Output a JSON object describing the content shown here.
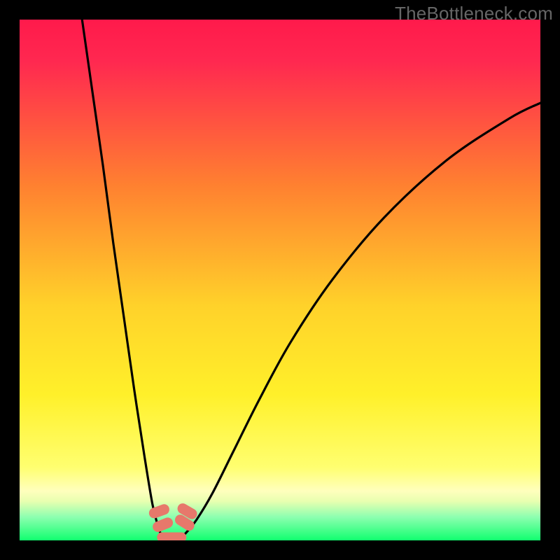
{
  "watermark": "TheBottleneck.com",
  "colors": {
    "frame": "#000000",
    "grad_top": "#ff1a4b",
    "grad_mid1": "#ff8f2a",
    "grad_mid2": "#fff02a",
    "grad_band_pale": "#ffffad",
    "grad_bottom": "#19ff7a",
    "curve_stroke": "#000000",
    "marker_fill": "#e7786b"
  },
  "chart_data": {
    "type": "line",
    "title": "",
    "xlabel": "",
    "ylabel": "",
    "xlim": [
      0,
      100
    ],
    "ylim": [
      0,
      100
    ],
    "series": [
      {
        "name": "left-branch",
        "x": [
          12,
          14,
          16,
          18,
          20,
          22,
          24,
          25.5,
          26.5,
          27,
          27.5,
          28
        ],
        "y": [
          100,
          86,
          72,
          57,
          43,
          29,
          16,
          7,
          3,
          1.5,
          1,
          0.5
        ]
      },
      {
        "name": "right-branch",
        "x": [
          31,
          32,
          34,
          37,
          41,
          46,
          52,
          60,
          70,
          82,
          94,
          100
        ],
        "y": [
          0.5,
          1.5,
          4,
          9,
          17,
          27,
          38,
          50,
          62,
          73,
          81,
          84
        ]
      },
      {
        "name": "valley-floor",
        "x": [
          27,
          28,
          29,
          30,
          31,
          32
        ],
        "y": [
          1.2,
          0.5,
          0.3,
          0.3,
          0.5,
          1.4
        ]
      }
    ],
    "markers": [
      {
        "name": "left-upper-marker",
        "x": 26.8,
        "y": 5.6,
        "shape": "capsule",
        "angle": 70
      },
      {
        "name": "left-lower-marker",
        "x": 27.5,
        "y": 3.0,
        "shape": "capsule",
        "angle": 68
      },
      {
        "name": "right-upper-marker",
        "x": 32.2,
        "y": 5.6,
        "shape": "capsule",
        "angle": -60
      },
      {
        "name": "right-lower-marker",
        "x": 31.7,
        "y": 3.4,
        "shape": "capsule",
        "angle": -58
      },
      {
        "name": "floor-marker",
        "x": 29.2,
        "y": 0.6,
        "shape": "bar",
        "angle": 0
      }
    ],
    "gradient_stops": [
      {
        "offset": 0.0,
        "color": "#ff1a4b"
      },
      {
        "offset": 0.08,
        "color": "#ff2850"
      },
      {
        "offset": 0.32,
        "color": "#ff8130"
      },
      {
        "offset": 0.55,
        "color": "#ffd22a"
      },
      {
        "offset": 0.72,
        "color": "#fff02a"
      },
      {
        "offset": 0.86,
        "color": "#ffff70"
      },
      {
        "offset": 0.905,
        "color": "#ffffbd"
      },
      {
        "offset": 0.925,
        "color": "#e8ffb0"
      },
      {
        "offset": 0.955,
        "color": "#8dffb0"
      },
      {
        "offset": 1.0,
        "color": "#11ff6f"
      }
    ]
  }
}
